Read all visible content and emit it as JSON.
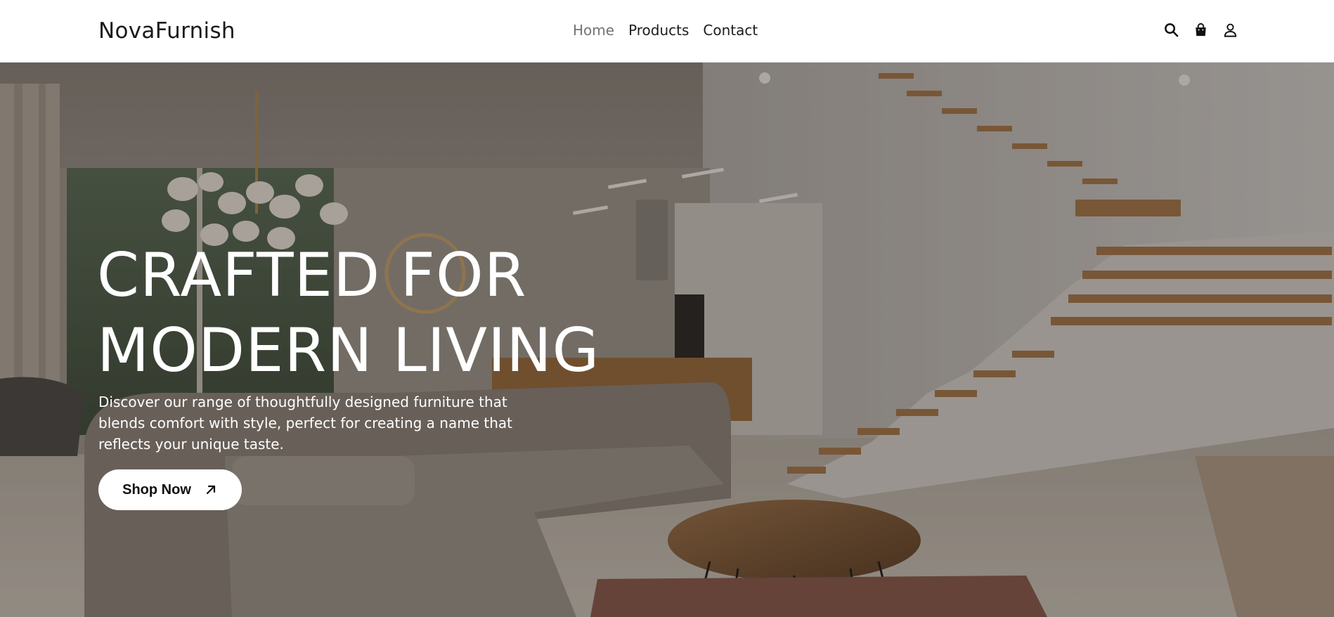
{
  "brand": {
    "name": "NovaFurnish"
  },
  "nav": {
    "items": [
      {
        "label": "Home",
        "active": true
      },
      {
        "label": "Products",
        "active": false
      },
      {
        "label": "Contact",
        "active": false
      }
    ]
  },
  "header_icons": [
    "search-icon",
    "shopping-bag-icon",
    "user-icon"
  ],
  "hero": {
    "title_line1": "CRAFTED FOR",
    "title_line2": "MODERN LIVING",
    "description": "Discover our range of thoughtfully designed furniture that blends comfort with style, perfect for creating a name that reflects your unique taste.",
    "cta_label": "Shop Now",
    "cta_icon": "arrow-up-right-icon",
    "background_image": "interior-living-room-with-staircase"
  },
  "colors": {
    "header_bg": "#ffffff",
    "nav_active": "#6f7479",
    "hero_text": "#ffffff",
    "button_bg": "#ffffff"
  }
}
